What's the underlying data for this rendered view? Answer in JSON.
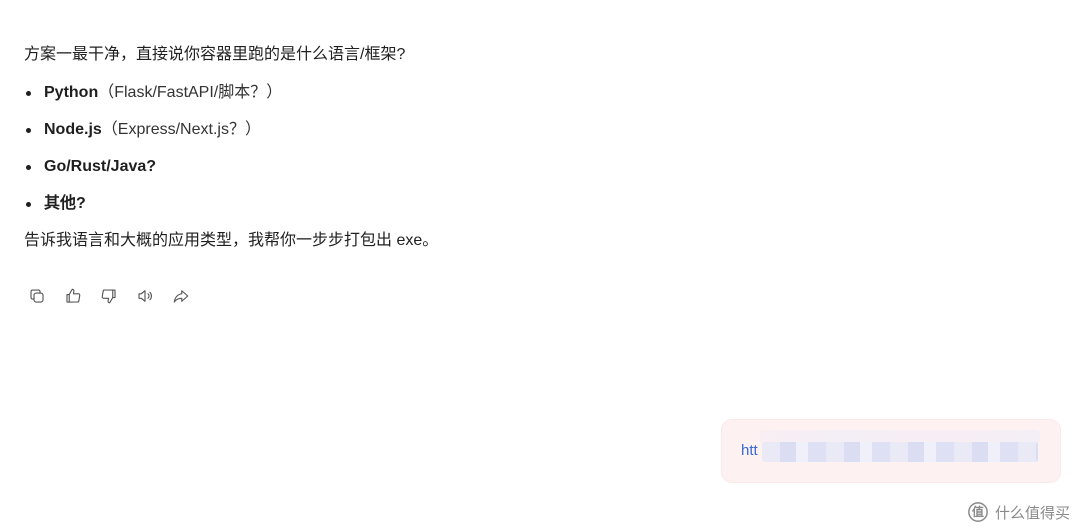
{
  "assistant": {
    "question": "方案一最干净，直接说你容器里跑的是什么语言/框架?",
    "options": [
      {
        "name": "Python",
        "note": "（Flask/FastAPI/脚本？）"
      },
      {
        "name": "Node.js",
        "note": "（Express/Next.js？）"
      },
      {
        "name": "Go/Rust/Java?",
        "note": ""
      },
      {
        "name": "其他?",
        "note": ""
      }
    ],
    "closing": "告诉我语言和大概的应用类型，我帮你一步步打包出 exe。"
  },
  "actions": [
    {
      "icon": "copy-icon"
    },
    {
      "icon": "thumbs-up-icon"
    },
    {
      "icon": "thumbs-down-icon"
    },
    {
      "icon": "speaker-icon"
    },
    {
      "icon": "share-icon"
    }
  ],
  "user_message": {
    "visible_text": "htt"
  },
  "watermark": {
    "text": "什么值得买"
  }
}
